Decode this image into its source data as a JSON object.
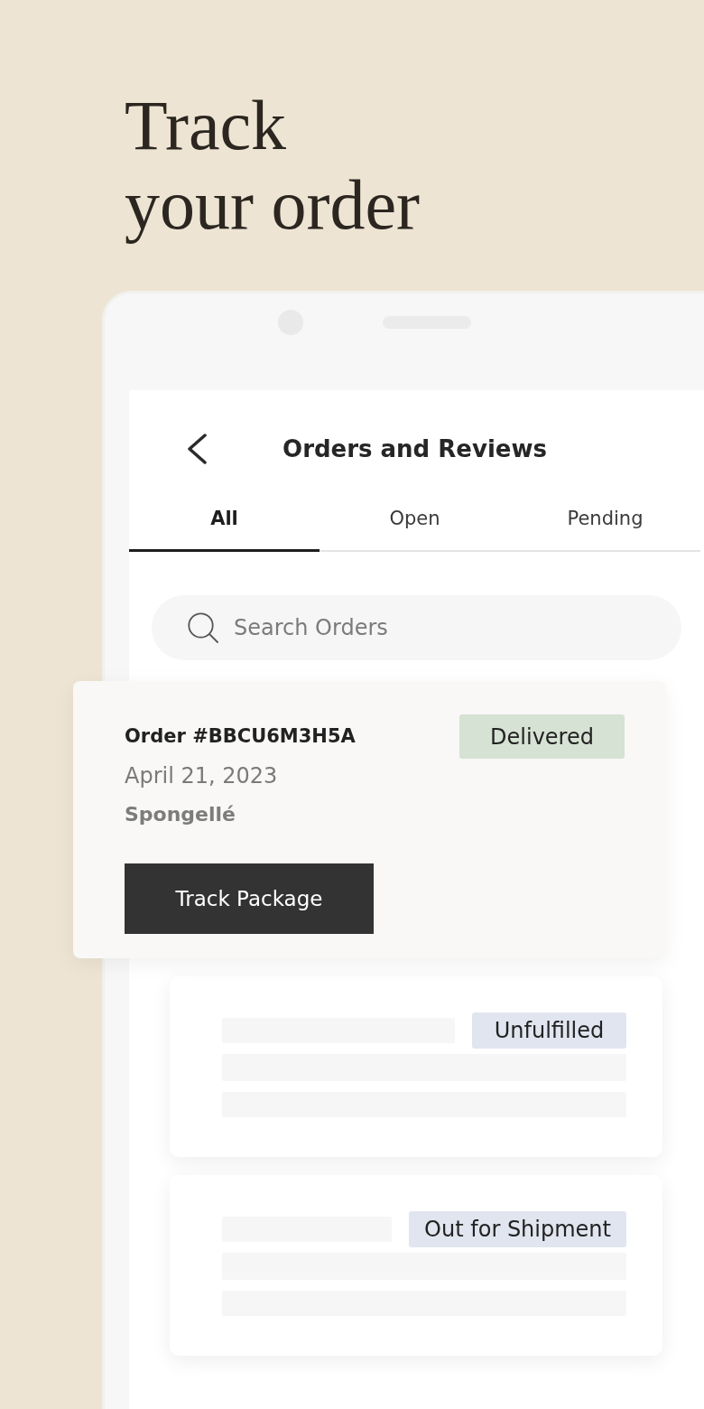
{
  "headline": "Track your order",
  "screen": {
    "title": "Orders and Reviews"
  },
  "tabs": [
    {
      "label": "All",
      "selected": true
    },
    {
      "label": "Open",
      "selected": false
    },
    {
      "label": "Pending",
      "selected": false
    }
  ],
  "search": {
    "placeholder": "Search Orders"
  },
  "orders": [
    {
      "kind": "detail",
      "title": "Order #BBCU6M3H5A",
      "date": "April 21, 2023",
      "seller": "Spongellé",
      "status": "Delivered",
      "color": "#d6e2d3",
      "action": "Track Package"
    },
    {
      "kind": "skeleton",
      "status": "Unfulfilled",
      "color": "#e1e5ef"
    },
    {
      "kind": "skeleton",
      "status": "Out for Shipment",
      "color": "#e1e5ef"
    }
  ]
}
